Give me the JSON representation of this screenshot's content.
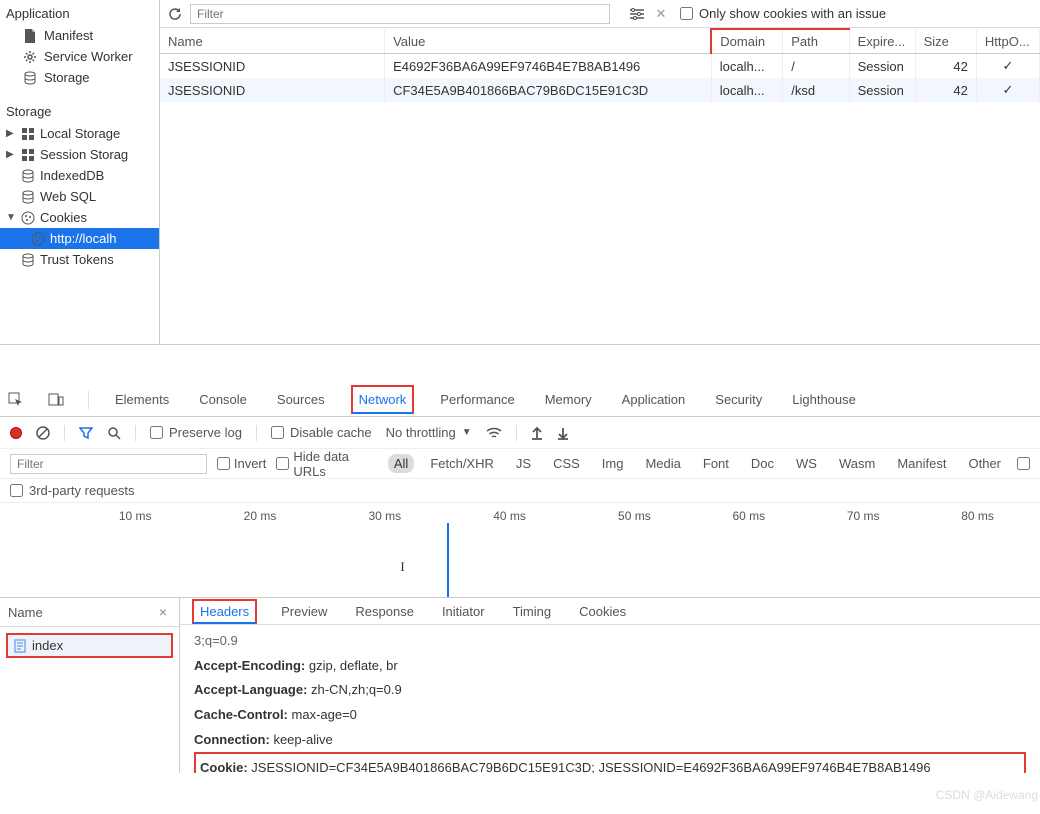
{
  "sidebar": {
    "application_heading": "Application",
    "application_items": [
      {
        "icon": "file-icon",
        "label": "Manifest"
      },
      {
        "icon": "gear-icon",
        "label": "Service Worker"
      },
      {
        "icon": "database-icon",
        "label": "Storage"
      }
    ],
    "storage_heading": "Storage",
    "storage_items": [
      {
        "caret": "▶",
        "icon": "grid-icon",
        "label": "Local Storage"
      },
      {
        "caret": "▶",
        "icon": "grid-icon",
        "label": "Session Storag"
      },
      {
        "caret": "",
        "icon": "database-icon",
        "label": "IndexedDB"
      },
      {
        "caret": "",
        "icon": "database-icon",
        "label": "Web SQL"
      },
      {
        "caret": "▼",
        "icon": "cookie-icon",
        "label": "Cookies"
      }
    ],
    "cookie_sub": {
      "icon": "cookie-icon",
      "label": "http://localh"
    },
    "trust_tokens": {
      "icon": "database-icon",
      "label": "Trust Tokens"
    }
  },
  "toolbar": {
    "filter_placeholder": "Filter",
    "only_issues_label": "Only show cookies with an issue"
  },
  "cookies_table": {
    "headers": [
      "Name",
      "Value",
      "Domain",
      "Path",
      "Expire...",
      "Size",
      "HttpO..."
    ],
    "rows": [
      {
        "name": "JSESSIONID",
        "value": "E4692F36BA6A99EF9746B4E7B8AB1496",
        "domain": "localh...",
        "path": "/",
        "expires": "Session",
        "size": "42",
        "httponly": "✓"
      },
      {
        "name": "JSESSIONID",
        "value": "CF34E5A9B401866BAC79B6DC15E91C3D",
        "domain": "localh...",
        "path": "/ksd",
        "expires": "Session",
        "size": "42",
        "httponly": "✓"
      }
    ]
  },
  "devtabs": [
    "Elements",
    "Console",
    "Sources",
    "Network",
    "Performance",
    "Memory",
    "Application",
    "Security",
    "Lighthouse"
  ],
  "devtabs_active": "Network",
  "nettools": {
    "preserve_log": "Preserve log",
    "disable_cache": "Disable cache",
    "throttling": "No throttling"
  },
  "filterbar": {
    "filter_placeholder": "Filter",
    "invert": "Invert",
    "hide_data_urls": "Hide data URLs",
    "types": [
      "All",
      "Fetch/XHR",
      "JS",
      "CSS",
      "Img",
      "Media",
      "Font",
      "Doc",
      "WS",
      "Wasm",
      "Manifest",
      "Other"
    ],
    "active_type": "All"
  },
  "third_party": "3rd-party requests",
  "timeline": {
    "ticks": [
      "10 ms",
      "20 ms",
      "30 ms",
      "40 ms",
      "50 ms",
      "60 ms",
      "70 ms",
      "80 ms"
    ],
    "cursor_index": 3
  },
  "reqlist": {
    "header": "Name",
    "items": [
      {
        "icon": "doc-icon",
        "label": "index"
      }
    ]
  },
  "detail_tabs": [
    "Headers",
    "Preview",
    "Response",
    "Initiator",
    "Timing",
    "Cookies"
  ],
  "detail_tab_active": "Headers",
  "headers": {
    "prev_line": "3;q=0.9",
    "entries": [
      {
        "key": "Accept-Encoding:",
        "val": "gzip, deflate, br"
      },
      {
        "key": "Accept-Language:",
        "val": "zh-CN,zh;q=0.9"
      },
      {
        "key": "Cache-Control:",
        "val": "max-age=0"
      },
      {
        "key": "Connection:",
        "val": "keep-alive"
      },
      {
        "key": "Cookie:",
        "val": "JSESSIONID=CF34E5A9B401866BAC79B6DC15E91C3D; JSESSIONID=E4692F36BA6A99EF9746B4E7B8AB1496"
      }
    ]
  },
  "watermark": "CSDN @Aidewang"
}
